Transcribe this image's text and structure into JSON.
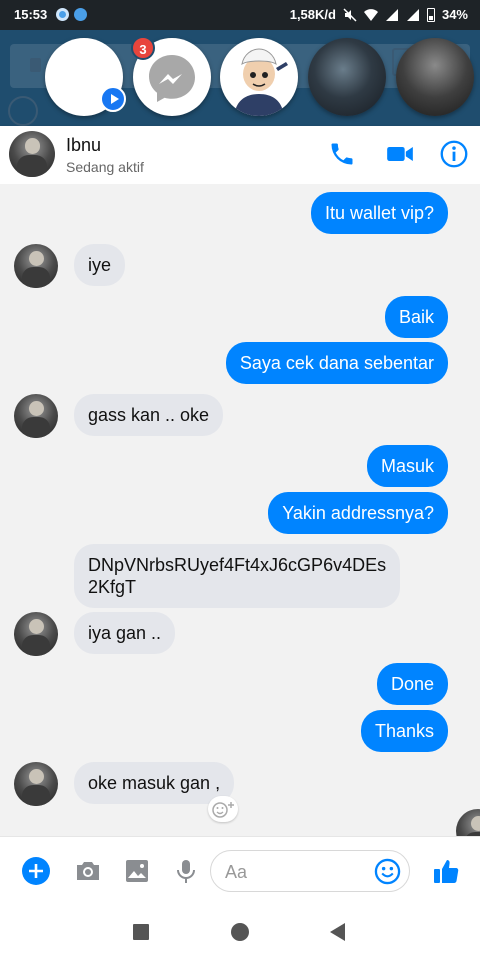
{
  "status_bar": {
    "time": "15:53",
    "speed": "1,58K/d",
    "battery": "34%"
  },
  "chat_heads": {
    "unread_badge": "3"
  },
  "header": {
    "name": "Ibnu",
    "status": "Sedang aktif",
    "accent_color": "#0084ff"
  },
  "messages": [
    {
      "side": "out",
      "text": "Itu wallet vip?"
    },
    {
      "side": "in",
      "text": "iye"
    },
    {
      "side": "out",
      "text": "Baik"
    },
    {
      "side": "out",
      "text": "Saya cek dana sebentar"
    },
    {
      "side": "in",
      "text": "gass kan .. oke"
    },
    {
      "side": "out",
      "text": "Masuk"
    },
    {
      "side": "out",
      "text": "Yakin addressnya?"
    },
    {
      "side": "in",
      "text_lines": [
        "DNpVNrbsRUyef4Ft4xJ6cGP6v4DEs",
        "2KfgT"
      ]
    },
    {
      "side": "in",
      "text": "iya gan .."
    },
    {
      "side": "out",
      "text": "Done"
    },
    {
      "side": "out",
      "text": "Thanks"
    },
    {
      "side": "in",
      "text": "oke masuk gan ,"
    }
  ],
  "composer": {
    "placeholder": "Aa"
  },
  "icons": {
    "header": [
      "phone-icon",
      "video-camera-icon",
      "info-icon"
    ],
    "composer": [
      "add-icon",
      "camera-icon",
      "gallery-icon",
      "microphone-icon",
      "emoji-icon",
      "thumbs-up-icon"
    ],
    "nav": [
      "recent-apps-icon",
      "home-icon",
      "back-icon"
    ]
  }
}
